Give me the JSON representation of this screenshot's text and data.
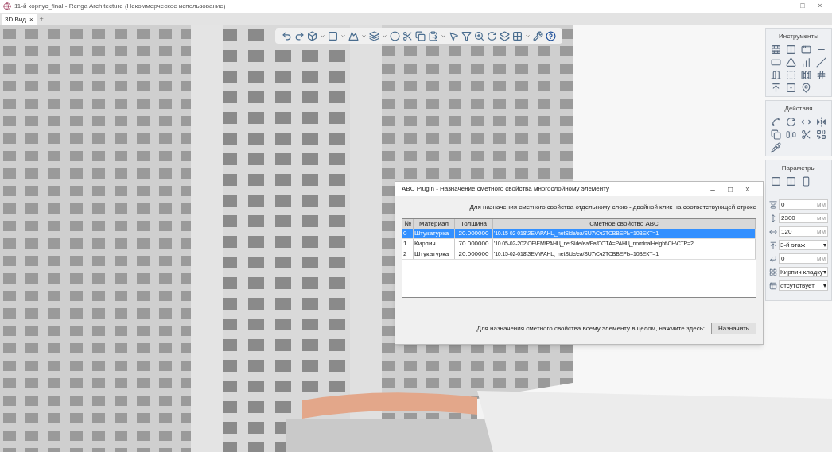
{
  "window": {
    "title": "11-й корпус_final - Renga Architecture (Некоммерческое использование)",
    "controls": [
      "–",
      "□",
      "×"
    ]
  },
  "tabs": [
    {
      "label": "3D Вид",
      "close": "×",
      "selected": true
    }
  ],
  "new_tab": "+",
  "panel": {
    "sections": [
      {
        "title": "Инструменты"
      },
      {
        "title": "Действия"
      },
      {
        "title": "Параметры",
        "fields": [
          {
            "kind": "number",
            "value": "0",
            "unit": "мм"
          },
          {
            "kind": "number",
            "value": "2300",
            "unit": "мм"
          },
          {
            "kind": "number",
            "value": "120",
            "unit": "мм"
          },
          {
            "kind": "select",
            "value": "3-й этаж",
            "arrow": "▾"
          },
          {
            "kind": "number",
            "value": "0",
            "unit": "мм"
          },
          {
            "kind": "select",
            "value": "Кирпич кладку",
            "arrow": "▾"
          },
          {
            "kind": "select",
            "value": "отсутствует",
            "arrow": "▾"
          }
        ]
      }
    ]
  },
  "dialog": {
    "title": "ABC Plugin - Назначение сметного свойства многослойному элементу",
    "controls": [
      "–",
      "□",
      "×"
    ],
    "hint": "Для назначения сметного свойства отдельному слою - двойной клик на соответствующей строке",
    "table": {
      "columns": [
        "№",
        "Материал",
        "Толщина",
        "Сметное свойство ABC"
      ],
      "rows": [
        {
          "cells": [
            "0",
            "Штукатурка",
            "20.000000",
            "'10.15-02-018\\ЗЕМ\\РАНЦ_netSide/ea/SU7\\Сч2ТСВВЕРЬ=10ВЕКТ=1'"
          ],
          "selected": true
        },
        {
          "cells": [
            "1",
            "Кирпич",
            "70.000000",
            "'10.05-02-202\\ОЕ\\ЕМ\\РАНЦ_netSide/ea/Ев/СОТА=РАНЦ_nominalHeight\\СН\\СТР=2'"
          ],
          "selected": false
        },
        {
          "cells": [
            "2",
            "Штукатурка",
            "20.000000",
            "'10.15-02-018\\ЗЕМ\\РАНЦ_netSide/ea/SU7\\Сч2ТСВВЕРЬ=10ВЕКТ=1'"
          ],
          "selected": false
        }
      ]
    },
    "footer": "Для назначения сметного свойства всему элементу в целом, нажмите здесь:",
    "button": "Назначить"
  }
}
